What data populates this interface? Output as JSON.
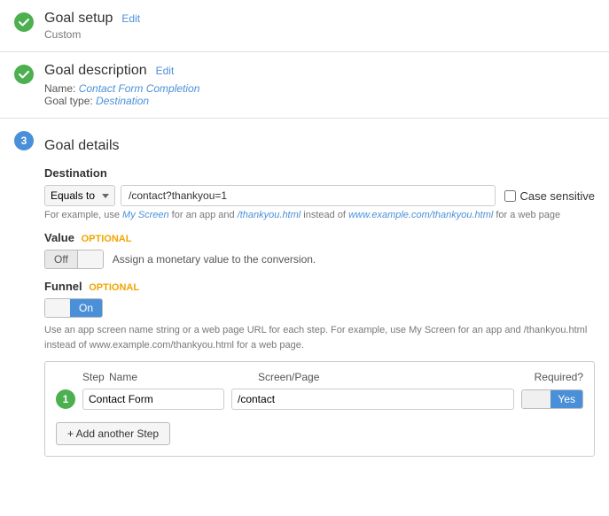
{
  "sections": {
    "goal_setup": {
      "title": "Goal setup",
      "edit_label": "Edit",
      "subtitle": "Custom",
      "status": "completed"
    },
    "goal_description": {
      "title": "Goal description",
      "edit_label": "Edit",
      "name_label": "Name:",
      "name_value": "Contact Form Completion",
      "type_label": "Goal type:",
      "type_value": "Destination",
      "status": "completed"
    },
    "goal_details": {
      "title": "Goal details",
      "step_number": "3",
      "destination": {
        "label": "Destination",
        "equals_option": "Equals to",
        "input_value": "/contact?thankyou=1",
        "case_sensitive_label": "Case sensitive"
      },
      "help_text_parts": [
        "For example, use ",
        "My Screen",
        " for an app and ",
        "/thankyou.html",
        " instead of ",
        "www.example.com/thankyou.html",
        " for a web page"
      ],
      "value_section": {
        "label": "Value",
        "optional_label": "OPTIONAL",
        "toggle_off": "Off",
        "assign_text": "Assign a monetary value to the conversion."
      },
      "funnel_section": {
        "label": "Funnel",
        "optional_label": "OPTIONAL",
        "toggle_off_label": "",
        "toggle_on_label": "On",
        "help_text_parts": [
          "Use an app screen name string or a web page URL for each step. For example, use ",
          "My Screen",
          " for an app and ",
          "/thankyou.html",
          "\ninstead of ",
          "www.example.com/thankyou.html",
          " for a web page."
        ],
        "table": {
          "col_step": "Step",
          "col_name": "Name",
          "col_screen": "Screen/Page",
          "col_required": "Required?",
          "rows": [
            {
              "step": "1",
              "name": "Contact Form",
              "screen": "/contact",
              "required": "Yes"
            }
          ]
        },
        "add_step_label": "+ Add another Step"
      }
    }
  }
}
